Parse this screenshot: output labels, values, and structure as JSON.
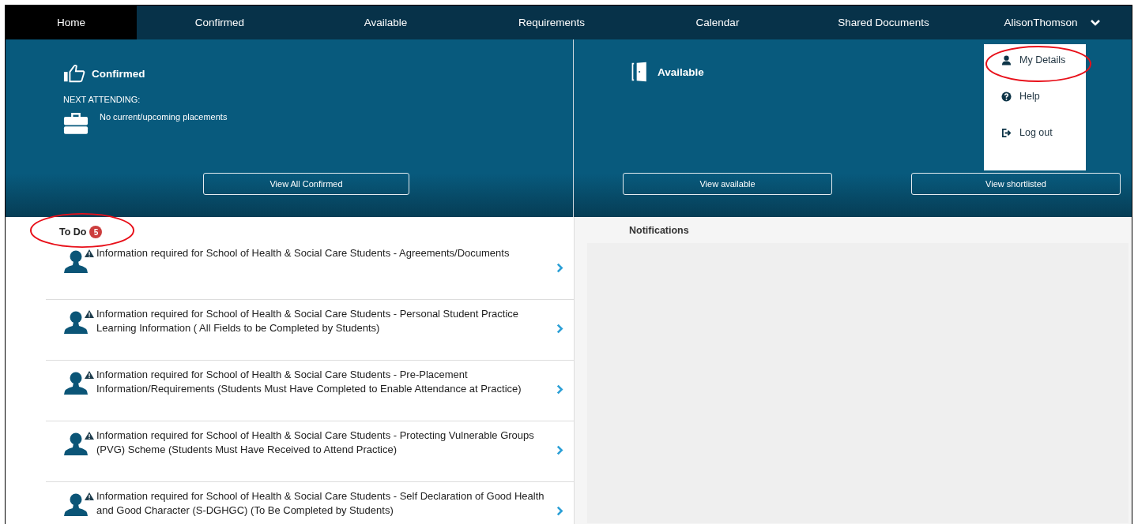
{
  "nav": [
    {
      "label": "Home",
      "selected": true
    },
    {
      "label": "Confirmed",
      "selected": false
    },
    {
      "label": "Available",
      "selected": false
    },
    {
      "label": "Requirements",
      "selected": false
    },
    {
      "label": "Calendar",
      "selected": false
    },
    {
      "label": "Shared Documents",
      "selected": false
    }
  ],
  "user_menu": {
    "label": "AlisonThomson",
    "expanded": true,
    "items": [
      {
        "kind": "details",
        "label": "My Details",
        "annotated": true
      },
      {
        "kind": "help",
        "label": "Help",
        "annotated": false
      },
      {
        "kind": "logout",
        "label": "Log out",
        "annotated": false
      }
    ]
  },
  "confirmed_panel": {
    "title": "Confirmed",
    "next_label": "NEXT ATTENDING:",
    "placement": "No current/upcoming placements",
    "button": "View All Confirmed"
  },
  "available_panel": {
    "title": "Available",
    "buttons": [
      "View available",
      "View shortlisted"
    ]
  },
  "todo": {
    "title": "To Do",
    "count": "5",
    "annotated": true,
    "items": [
      {
        "text": "Information required for School of Health & Social Care Students - Agreements/Documents"
      },
      {
        "text": "Information required for School of Health & Social Care Students - Personal Student Practice Learning Information ( All Fields to be Completed by Students)"
      },
      {
        "text": "Information required for School of Health & Social Care Students - Pre-Placement Information/Requirements (Students Must Have Completed to Enable Attendance at Practice)"
      },
      {
        "text": "Information required for School of Health & Social Care Students - Protecting Vulnerable Groups (PVG) Scheme (Students Must Have Received to Attend Practice)"
      },
      {
        "text": "Information required for School of Health & Social Care Students - Self Declaration of Good Health and Good Character (S-DGHGC) (To Be Completed by Students)"
      }
    ]
  },
  "notifications": {
    "title": "Notifications"
  }
}
